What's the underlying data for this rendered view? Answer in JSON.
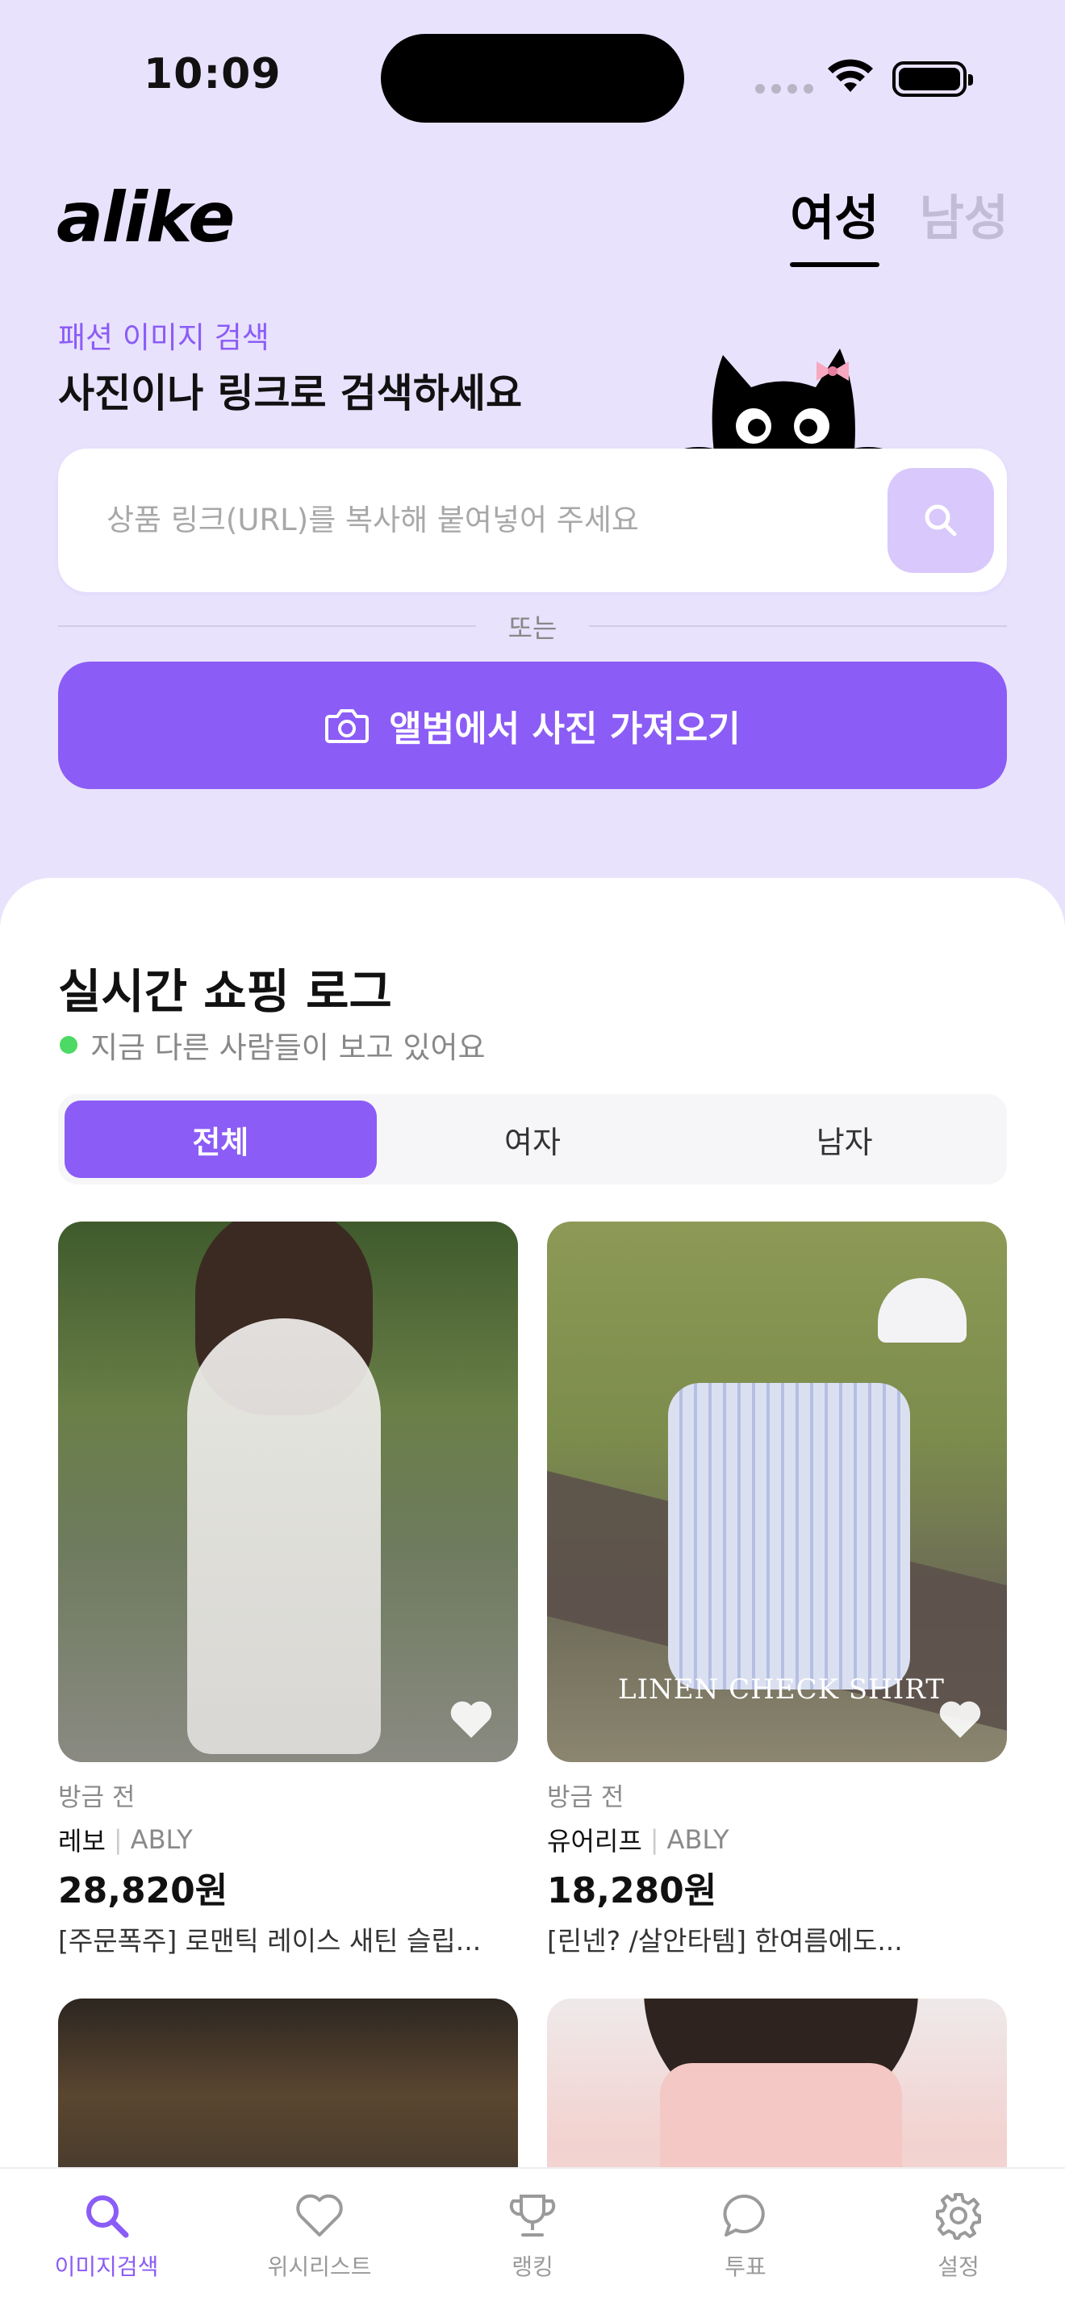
{
  "status_bar": {
    "time": "10:09"
  },
  "header": {
    "logo": "alike",
    "gender_tabs": [
      {
        "label": "여성",
        "active": true
      },
      {
        "label": "남성",
        "active": false
      }
    ]
  },
  "search": {
    "caption": "패션 이미지 검색",
    "heading": "사진이나 링크로 검색하세요",
    "placeholder": "상품 링크(URL)를 복사해 붙여넣어 주세요",
    "value": "",
    "or_label": "또는",
    "album_button": "앨범에서 사진 가져오기",
    "icon": "search-icon"
  },
  "shopping_log": {
    "title": "실시간 쇼핑 로그",
    "live_text": "지금 다른 사람들이 보고 있어요",
    "filters": [
      {
        "label": "전체",
        "active": true
      },
      {
        "label": "여자",
        "active": false
      },
      {
        "label": "남자",
        "active": false
      }
    ],
    "products": [
      {
        "time": "방금 전",
        "shop": "레보",
        "mall": "ABLY",
        "price": "28,820원",
        "name": "[주문폭주] 로맨틱 레이스 새틴 슬립..."
      },
      {
        "time": "방금 전",
        "shop": "유어리프",
        "mall": "ABLY",
        "price": "18,280원",
        "name": "[린넨?  /살안타템] 한여름에도...",
        "image_text": "LINEN CHECK SHIRT"
      }
    ]
  },
  "bottom_nav": [
    {
      "label": "이미지검색",
      "icon": "search-icon",
      "active": true
    },
    {
      "label": "위시리스트",
      "icon": "heart-icon",
      "active": false
    },
    {
      "label": "랭킹",
      "icon": "trophy-icon",
      "active": false
    },
    {
      "label": "투표",
      "icon": "chat-bubble-icon",
      "active": false
    },
    {
      "label": "설정",
      "icon": "gear-icon",
      "active": false
    }
  ],
  "colors": {
    "accent": "#8b5cf6",
    "background": "#e9e2fd",
    "live_dot": "#4cd964"
  }
}
